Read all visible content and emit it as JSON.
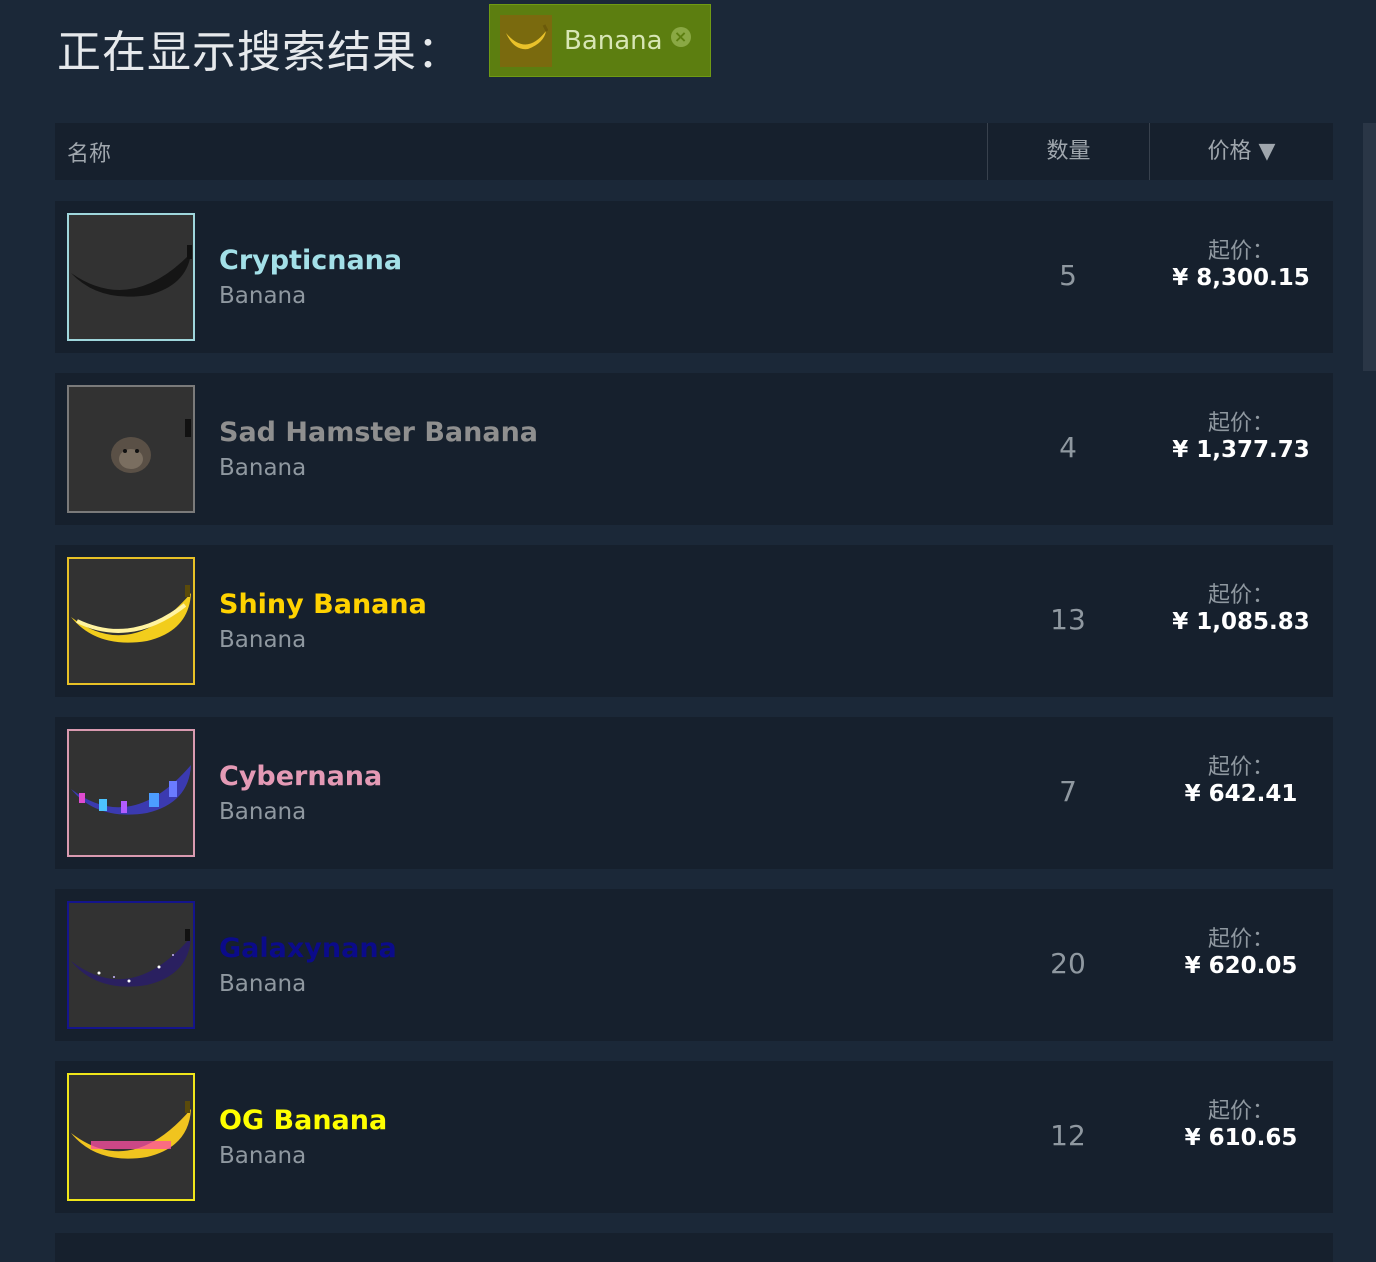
{
  "search": {
    "heading": "正在显示搜索结果：",
    "filter_label": "Banana",
    "filter_close": "×"
  },
  "table": {
    "col_name": "名称",
    "col_qty": "数量",
    "col_price": "价格 ▼"
  },
  "items": [
    {
      "name": "Crypticnana",
      "sub": "Banana",
      "qty": "5",
      "price_label": "起价：",
      "price": "¥ 8,300.15",
      "color": "#a3e0e8",
      "border": "#9fd6dc"
    },
    {
      "name": "Sad Hamster Banana",
      "sub": "Banana",
      "qty": "4",
      "price_label": "起价：",
      "price": "¥ 1,377.73",
      "color": "#8f8f8f",
      "border": "#7a7a7a"
    },
    {
      "name": "Shiny Banana",
      "sub": "Banana",
      "qty": "13",
      "price_label": "起价：",
      "price": "¥ 1,085.83",
      "color": "#ffd200",
      "border": "#e8c126"
    },
    {
      "name": "Cybernana",
      "sub": "Banana",
      "qty": "7",
      "price_label": "起价：",
      "price": "¥ 642.41",
      "color": "#e49ab5",
      "border": "#d99ab0"
    },
    {
      "name": "Galaxynana",
      "sub": "Banana",
      "qty": "20",
      "price_label": "起价：",
      "price": "¥ 620.05",
      "color": "#0b0b8a",
      "border": "#14148c"
    },
    {
      "name": "OG Banana",
      "sub": "Banana",
      "qty": "12",
      "price_label": "起价：",
      "price": "¥ 610.65",
      "color": "#ffff00",
      "border": "#f0e61a"
    }
  ]
}
